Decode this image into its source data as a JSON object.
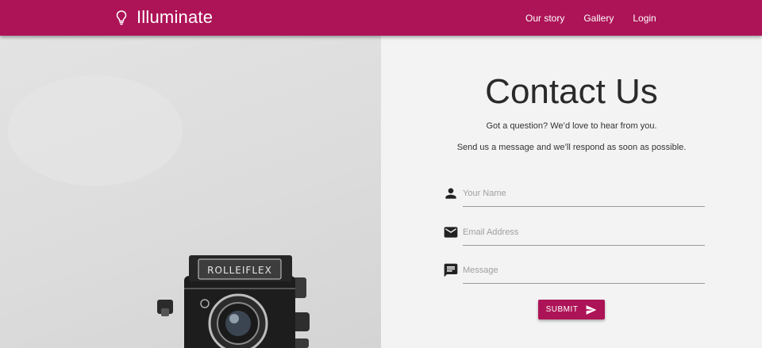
{
  "header": {
    "brand_icon": "lightbulb-icon",
    "brand_name": "Illuminate",
    "nav": [
      "Our story",
      "Gallery",
      "Login"
    ],
    "background_color": "#ad1457"
  },
  "hero": {
    "image_description_icon": "camera-photo",
    "camera_brand_text": "ROLLEIFLEX"
  },
  "contact": {
    "title": "Contact Us",
    "subtitle_1": "Got a question? We’d love to hear from you.",
    "subtitle_2": "Send us a message and we’ll respond as soon as possible.",
    "fields": {
      "name": {
        "icon": "person-icon",
        "placeholder": "Your Name",
        "value": ""
      },
      "email": {
        "icon": "envelope-icon",
        "placeholder": "Email Address",
        "value": ""
      },
      "message": {
        "icon": "chat-icon",
        "placeholder": "Message",
        "value": ""
      }
    },
    "submit_label": "SUBMIT",
    "submit_icon": "send-icon",
    "accent_color": "#ad1457"
  }
}
